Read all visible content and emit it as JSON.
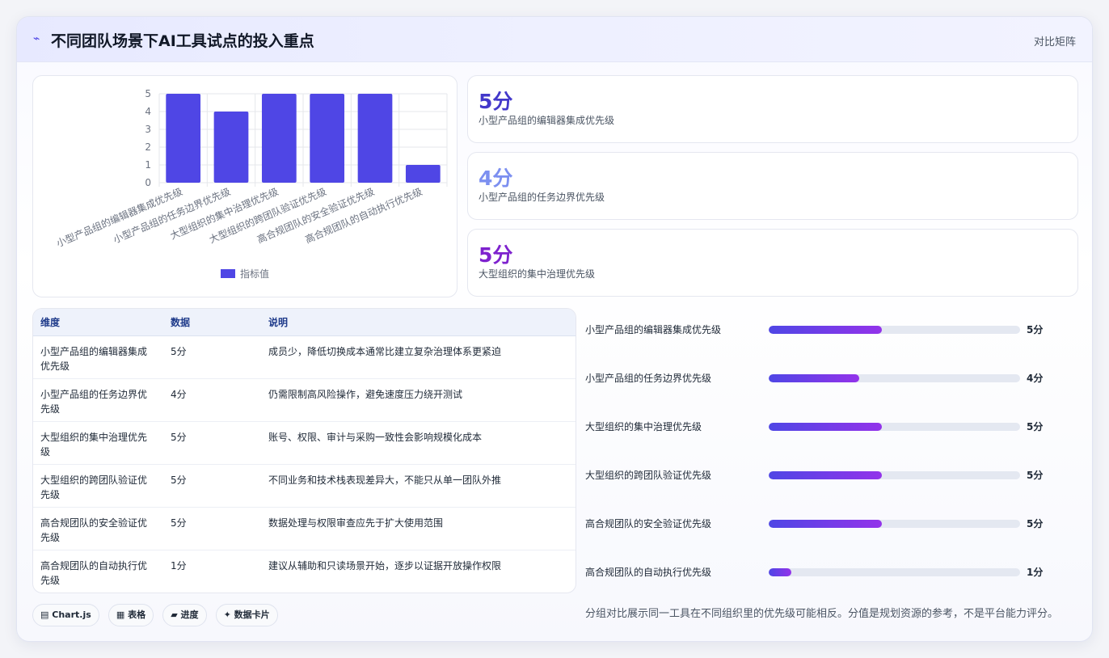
{
  "header": {
    "icon": "trend-icon",
    "title": "不同团队场景下AI工具试点的投入重点",
    "tag": "对比矩阵"
  },
  "chart_data": {
    "type": "bar",
    "categories": [
      "小型产品组的编辑器集成优先级",
      "小型产品组的任务边界优先级",
      "大型组织的集中治理优先级",
      "大型组织的跨团队验证优先级",
      "高合规团队的安全验证优先级",
      "高合规团队的自动执行优先级"
    ],
    "series": [
      {
        "name": "指标值",
        "values": [
          5,
          4,
          5,
          5,
          5,
          1
        ],
        "color": "#4f46e5"
      }
    ],
    "yticks": [
      0,
      1,
      2,
      3,
      4,
      5
    ],
    "ylim": [
      0,
      5
    ],
    "grid": true,
    "legend": "bottom"
  },
  "stats": [
    {
      "value": "5分",
      "label": "小型产品组的编辑器集成优先级",
      "color": "#4338ca"
    },
    {
      "value": "4分",
      "label": "小型产品组的任务边界优先级",
      "color": "#7c8ff0"
    },
    {
      "value": "5分",
      "label": "大型组织的集中治理优先级",
      "color": "#7e22ce"
    }
  ],
  "table": {
    "headers": [
      "维度",
      "数据",
      "说明"
    ],
    "rows": [
      [
        "小型产品组的编辑器集成优先级",
        "5分",
        "成员少，降低切换成本通常比建立复杂治理体系更紧迫"
      ],
      [
        "小型产品组的任务边界优先级",
        "4分",
        "仍需限制高风险操作，避免速度压力绕开测试"
      ],
      [
        "大型组织的集中治理优先级",
        "5分",
        "账号、权限、审计与采购一致性会影响规模化成本"
      ],
      [
        "大型组织的跨团队验证优先级",
        "5分",
        "不同业务和技术栈表现差异大，不能只从单一团队外推"
      ],
      [
        "高合规团队的安全验证优先级",
        "5分",
        "数据处理与权限审查应先于扩大使用范围"
      ],
      [
        "高合规团队的自动执行优先级",
        "1分",
        "建议从辅助和只读场景开始，逐步以证据开放操作权限"
      ]
    ]
  },
  "bars": [
    {
      "label": "小型产品组的编辑器集成优先级",
      "value": "5分",
      "fraction": 0.45
    },
    {
      "label": "小型产品组的任务边界优先级",
      "value": "4分",
      "fraction": 0.36
    },
    {
      "label": "大型组织的集中治理优先级",
      "value": "5分",
      "fraction": 0.45
    },
    {
      "label": "大型组织的跨团队验证优先级",
      "value": "5分",
      "fraction": 0.45
    },
    {
      "label": "高合规团队的安全验证优先级",
      "value": "5分",
      "fraction": 0.45
    },
    {
      "label": "高合规团队的自动执行优先级",
      "value": "1分",
      "fraction": 0.09
    }
  ],
  "note": "分组对比展示同一工具在不同组织里的优先级可能相反。分值是规划资源的参考，不是平台能力评分。",
  "chips": [
    {
      "icon": "chart-icon",
      "glyph": "▤",
      "label": "Chart.js"
    },
    {
      "icon": "table-icon",
      "glyph": "▦",
      "label": "表格"
    },
    {
      "icon": "progress-icon",
      "glyph": "▰",
      "label": "进度"
    },
    {
      "icon": "card-icon",
      "glyph": "✦",
      "label": "数据卡片"
    }
  ]
}
